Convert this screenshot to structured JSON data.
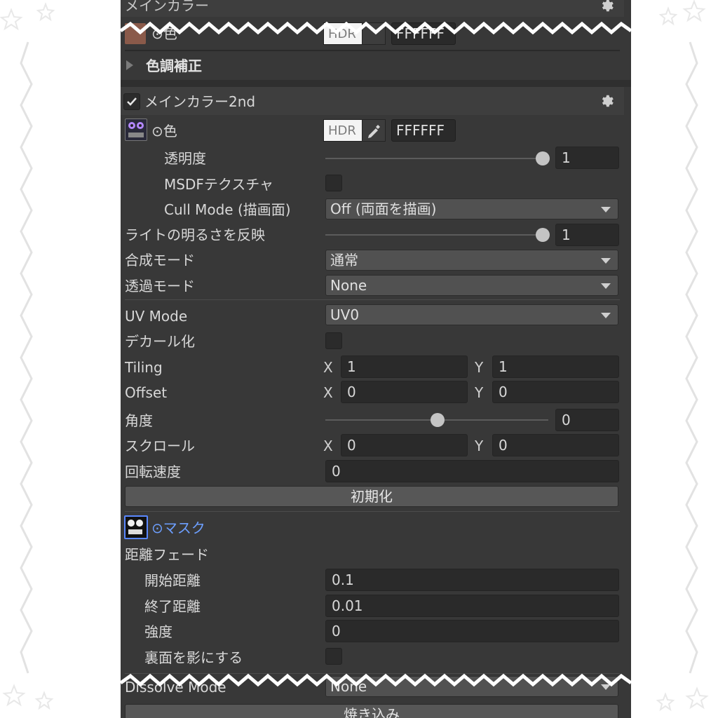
{
  "sections": {
    "main_color": {
      "title": "メインカラー",
      "color_label": "⊙色",
      "hdr": "HDR",
      "hex": "FFFFFF"
    },
    "color_adjust": {
      "label": "色調補正"
    },
    "main_color_2nd": {
      "title": "メインカラー2nd"
    }
  },
  "color": {
    "label": "⊙色",
    "hdr": "HDR",
    "hex": "FFFFFF"
  },
  "opacity": {
    "label": "透明度",
    "value": "1",
    "level": 1
  },
  "msdf": {
    "label": "MSDFテクスチャ"
  },
  "cull_mode": {
    "label": "Cull Mode (描画面)",
    "value": "Off (両面を描画)"
  },
  "light": {
    "label": "ライトの明るさを反映",
    "value": "1",
    "level": 1
  },
  "blend_mode": {
    "label": "合成モード",
    "value": "通常"
  },
  "alpha_mode": {
    "label": "透過モード",
    "value": "None"
  },
  "uv_mode": {
    "label": "UV Mode",
    "value": "UV0"
  },
  "decal": {
    "label": "デカール化"
  },
  "tiling": {
    "label": "Tiling",
    "x_label": "X",
    "x": "1",
    "y_label": "Y",
    "y": "1"
  },
  "offset": {
    "label": "Offset",
    "x_label": "X",
    "x": "0",
    "y_label": "Y",
    "y": "0"
  },
  "angle": {
    "label": "角度",
    "value": "0",
    "level": 0.5
  },
  "scroll": {
    "label": "スクロール",
    "x_label": "X",
    "x": "0",
    "y_label": "Y",
    "y": "0"
  },
  "rotation_speed": {
    "label": "回転速度",
    "value": "0"
  },
  "reset_button": {
    "label": "初期化"
  },
  "mask": {
    "label": "⊙マスク"
  },
  "distance_fade": {
    "label": "距離フェード",
    "start": {
      "label": "開始距離",
      "value": "0.1"
    },
    "end": {
      "label": "終了距離",
      "value": "0.01"
    },
    "strength": {
      "label": "強度",
      "value": "0"
    },
    "backface_shadow": {
      "label": "裏面を影にする"
    }
  },
  "dissolve_mode": {
    "label": "Dissolve Mode",
    "value": "None"
  },
  "bake_button": {
    "label": "焼き込み"
  },
  "colors": {
    "panel_bg": "#383838",
    "header_bg": "#3e3e3e",
    "mask_label": "#6d9fff",
    "mask_texture_border": "#5a88ff"
  }
}
